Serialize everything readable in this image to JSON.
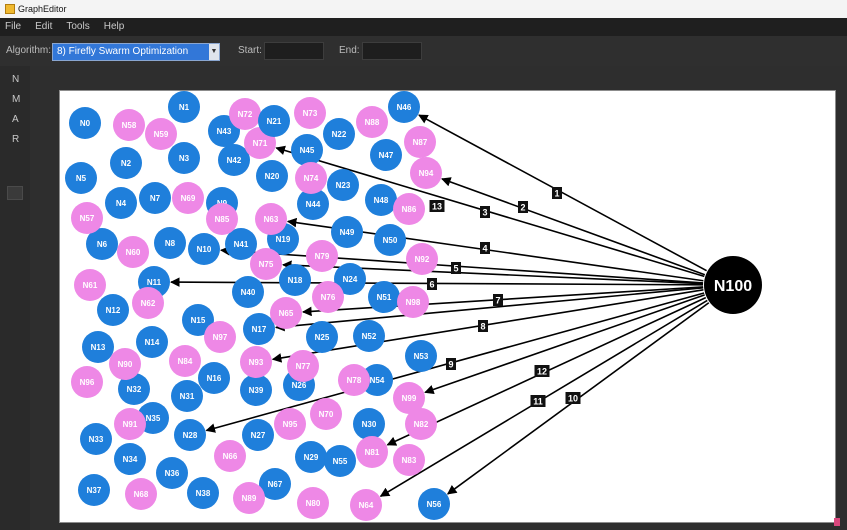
{
  "window": {
    "title": "GraphEditor"
  },
  "menu": [
    "File",
    "Edit",
    "Tools",
    "Help"
  ],
  "toolbar": {
    "algorithm_label": "Algorithm:",
    "algorithm_value": "8) Firefly Swarm Optimization",
    "start_label": "Start:",
    "end_label": "End:",
    "start_value": "",
    "end_value": ""
  },
  "sidebar_tabs": [
    "N",
    "M",
    "A",
    "R"
  ],
  "colors": {
    "blue_node": "#1f7fdb",
    "pink_node": "#ee88e6",
    "hub_node": "#000000",
    "edge_label_bg": "#111111"
  },
  "hub": {
    "id": "N100"
  },
  "nodes": [
    {
      "id": "N0",
      "c": "blue"
    },
    {
      "id": "N1",
      "c": "blue"
    },
    {
      "id": "N2",
      "c": "blue"
    },
    {
      "id": "N3",
      "c": "blue"
    },
    {
      "id": "N4",
      "c": "blue"
    },
    {
      "id": "N5",
      "c": "blue"
    },
    {
      "id": "N6",
      "c": "blue"
    },
    {
      "id": "N7",
      "c": "blue"
    },
    {
      "id": "N8",
      "c": "blue"
    },
    {
      "id": "N9",
      "c": "blue"
    },
    {
      "id": "N10",
      "c": "blue"
    },
    {
      "id": "N11",
      "c": "blue"
    },
    {
      "id": "N12",
      "c": "blue"
    },
    {
      "id": "N13",
      "c": "blue"
    },
    {
      "id": "N14",
      "c": "blue"
    },
    {
      "id": "N15",
      "c": "blue"
    },
    {
      "id": "N16",
      "c": "blue"
    },
    {
      "id": "N17",
      "c": "blue"
    },
    {
      "id": "N18",
      "c": "blue"
    },
    {
      "id": "N19",
      "c": "blue"
    },
    {
      "id": "N20",
      "c": "blue"
    },
    {
      "id": "N22",
      "c": "blue"
    },
    {
      "id": "N23",
      "c": "blue"
    },
    {
      "id": "N24",
      "c": "blue"
    },
    {
      "id": "N25",
      "c": "blue"
    },
    {
      "id": "N26",
      "c": "blue"
    },
    {
      "id": "N27",
      "c": "blue"
    },
    {
      "id": "N28",
      "c": "blue"
    },
    {
      "id": "N29",
      "c": "blue"
    },
    {
      "id": "N30",
      "c": "blue"
    },
    {
      "id": "N31",
      "c": "blue"
    },
    {
      "id": "N32",
      "c": "blue"
    },
    {
      "id": "N33",
      "c": "blue"
    },
    {
      "id": "N34",
      "c": "blue"
    },
    {
      "id": "N35",
      "c": "blue"
    },
    {
      "id": "N36",
      "c": "blue"
    },
    {
      "id": "N37",
      "c": "blue"
    },
    {
      "id": "N38",
      "c": "blue"
    },
    {
      "id": "N39",
      "c": "blue"
    },
    {
      "id": "N40",
      "c": "blue"
    },
    {
      "id": "N41",
      "c": "blue"
    },
    {
      "id": "N42",
      "c": "blue"
    },
    {
      "id": "N43",
      "c": "blue"
    },
    {
      "id": "N44",
      "c": "blue"
    },
    {
      "id": "N45",
      "c": "blue"
    },
    {
      "id": "N46",
      "c": "blue"
    },
    {
      "id": "N47",
      "c": "blue"
    },
    {
      "id": "N48",
      "c": "blue"
    },
    {
      "id": "N49",
      "c": "blue"
    },
    {
      "id": "N50",
      "c": "blue"
    },
    {
      "id": "N51",
      "c": "blue"
    },
    {
      "id": "N52",
      "c": "blue"
    },
    {
      "id": "N53",
      "c": "blue"
    },
    {
      "id": "N54",
      "c": "blue"
    },
    {
      "id": "N55",
      "c": "blue"
    },
    {
      "id": "N56",
      "c": "blue"
    },
    {
      "id": "N57",
      "c": "pink"
    },
    {
      "id": "N58",
      "c": "pink"
    },
    {
      "id": "N59",
      "c": "pink"
    },
    {
      "id": "N60",
      "c": "pink"
    },
    {
      "id": "N61",
      "c": "pink"
    },
    {
      "id": "N62",
      "c": "pink"
    },
    {
      "id": "N63",
      "c": "pink"
    },
    {
      "id": "N64",
      "c": "pink"
    },
    {
      "id": "N65",
      "c": "pink"
    },
    {
      "id": "N66",
      "c": "pink"
    },
    {
      "id": "N67",
      "c": "blue"
    },
    {
      "id": "N68",
      "c": "pink"
    },
    {
      "id": "N69",
      "c": "pink"
    },
    {
      "id": "N70",
      "c": "pink"
    },
    {
      "id": "N71",
      "c": "pink"
    },
    {
      "id": "N72",
      "c": "pink"
    },
    {
      "id": "N73",
      "c": "pink"
    },
    {
      "id": "N74",
      "c": "pink"
    },
    {
      "id": "N75",
      "c": "pink"
    },
    {
      "id": "N76",
      "c": "pink"
    },
    {
      "id": "N77",
      "c": "pink"
    },
    {
      "id": "N78",
      "c": "pink"
    },
    {
      "id": "N79",
      "c": "pink"
    },
    {
      "id": "N80",
      "c": "pink"
    },
    {
      "id": "N81",
      "c": "pink"
    },
    {
      "id": "N82",
      "c": "pink"
    },
    {
      "id": "N83",
      "c": "pink"
    },
    {
      "id": "N84",
      "c": "pink"
    },
    {
      "id": "N85",
      "c": "pink"
    },
    {
      "id": "N86",
      "c": "pink"
    },
    {
      "id": "N87",
      "c": "pink"
    },
    {
      "id": "N88",
      "c": "pink"
    },
    {
      "id": "N89",
      "c": "pink"
    },
    {
      "id": "N90",
      "c": "pink"
    },
    {
      "id": "N91",
      "c": "pink"
    },
    {
      "id": "N92",
      "c": "pink"
    },
    {
      "id": "N93",
      "c": "pink"
    },
    {
      "id": "N94",
      "c": "pink"
    },
    {
      "id": "N95",
      "c": "pink"
    },
    {
      "id": "N96",
      "c": "pink"
    },
    {
      "id": "N97",
      "c": "pink"
    },
    {
      "id": "N98",
      "c": "pink"
    },
    {
      "id": "N99",
      "c": "pink"
    },
    {
      "id": "N21",
      "c": "blue"
    }
  ],
  "edges": [
    {
      "to": "N46",
      "label": "1"
    },
    {
      "to": "N94",
      "label": "2"
    },
    {
      "to": "N71",
      "label": "3"
    },
    {
      "to": "N63",
      "label": "13"
    },
    {
      "to": "N10",
      "label": "4"
    },
    {
      "to": "N75",
      "label": "5"
    },
    {
      "to": "N11",
      "label": "6"
    },
    {
      "to": "N65",
      "label": "7"
    },
    {
      "to": "N17",
      "label": "8"
    },
    {
      "to": "N93",
      "label": "9"
    },
    {
      "to": "N99",
      "label": "12"
    },
    {
      "to": "N28",
      "label": "11"
    },
    {
      "to": "N81",
      "label": "10"
    },
    {
      "to": "N64",
      "label": ""
    },
    {
      "to": "N56",
      "label": ""
    }
  ]
}
